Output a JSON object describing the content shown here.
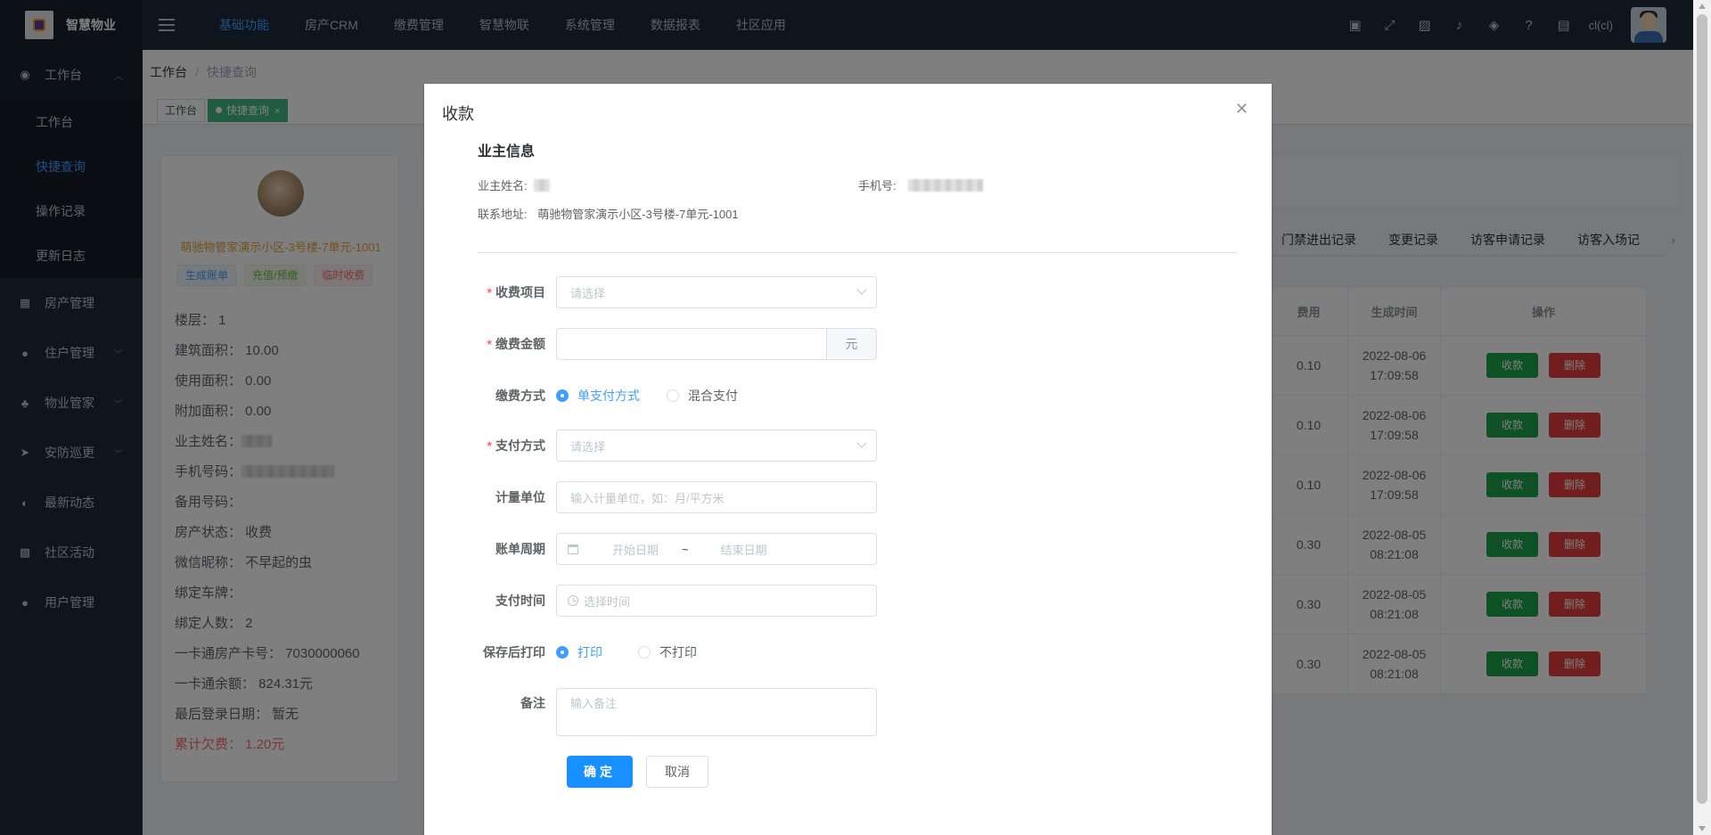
{
  "app": {
    "title": "智慧物业"
  },
  "topnav": [
    {
      "label": "基础功能",
      "active": true
    },
    {
      "label": "房产CRM"
    },
    {
      "label": "缴费管理"
    },
    {
      "label": "智慧物联"
    },
    {
      "label": "系统管理"
    },
    {
      "label": "数据报表"
    },
    {
      "label": "社区应用"
    }
  ],
  "header": {
    "user": "cl(cl)"
  },
  "sidebar": {
    "workbench": "工作台",
    "sub": [
      "工作台",
      "快捷查询",
      "操作记录",
      "更新日志"
    ],
    "items": [
      "房产管理",
      "住户管理",
      "物业管家",
      "安防巡更",
      "最新动态",
      "社区活动",
      "用户管理"
    ]
  },
  "breadcrumb": {
    "root": "工作台",
    "current": "快捷查询"
  },
  "tags": {
    "home": "工作台",
    "current": "快捷查询"
  },
  "owner_card": {
    "title": "萌驰物管家演示小区-3号楼-7单元-1001",
    "buttons": [
      "生成账单",
      "充值/预缴",
      "临时收费"
    ],
    "rows": [
      "楼层：  1",
      "建筑面积：  10.00",
      "使用面积：  0.00",
      "附加面积：  0.00",
      "业主姓名：",
      "手机号码：",
      "备用号码：",
      "房产状态：  收费",
      "微信昵称：  不早起的虫",
      "绑定车牌：",
      "绑定人数：  2",
      "一卡通房产卡号：  7030000060",
      "一卡通余额：  824.31元",
      "最后登录日期：  暂无"
    ],
    "debt": "累计欠费：  1.20元"
  },
  "right_tabs": [
    "门禁进出记录",
    "变更记录",
    "访客申请记录",
    "访客入场记"
  ],
  "table": {
    "headers": [
      "费用",
      "生成时间",
      "操作"
    ],
    "rows": [
      {
        "fee": "0.10",
        "date": "2022-08-06",
        "time": "17:09:58"
      },
      {
        "fee": "0.10",
        "date": "2022-08-06",
        "time": "17:09:58"
      },
      {
        "fee": "0.10",
        "date": "2022-08-06",
        "time": "17:09:58"
      },
      {
        "fee": "0.30",
        "date": "2022-08-05",
        "time": "08:21:08"
      },
      {
        "fee": "0.30",
        "date": "2022-08-05",
        "time": "08:21:08"
      },
      {
        "fee": "0.30",
        "date": "2022-08-05",
        "time": "08:21:08"
      }
    ],
    "collect_label": "收款",
    "delete_label": "删除"
  },
  "modal": {
    "title": "收款",
    "section": "业主信息",
    "owner_name_label": "业主姓名:",
    "phone_label": "手机号:",
    "address_label": "联系地址:",
    "address": "萌驰物管家演示小区-3号楼-7单元-1001",
    "fields": {
      "fee_item": {
        "label": "收费项目",
        "placeholder": "请选择"
      },
      "amount": {
        "label": "缴费金额",
        "unit": "元"
      },
      "pay_mode": {
        "label": "缴费方式",
        "options": [
          "单支付方式",
          "混合支付"
        ]
      },
      "pay_method": {
        "label": "支付方式",
        "placeholder": "请选择"
      },
      "unit": {
        "label": "计量单位",
        "placeholder": "输入计量单位，如：月/平方米"
      },
      "period": {
        "label": "账单周期",
        "start": "开始日期",
        "sep": "~",
        "end": "结束日期"
      },
      "pay_time": {
        "label": "支付时间",
        "placeholder": "选择时间"
      },
      "print": {
        "label": "保存后打印",
        "options": [
          "打印",
          "不打印"
        ]
      },
      "remark": {
        "label": "备注",
        "placeholder": "输入备注"
      }
    },
    "confirm": "确定",
    "cancel": "取消"
  }
}
